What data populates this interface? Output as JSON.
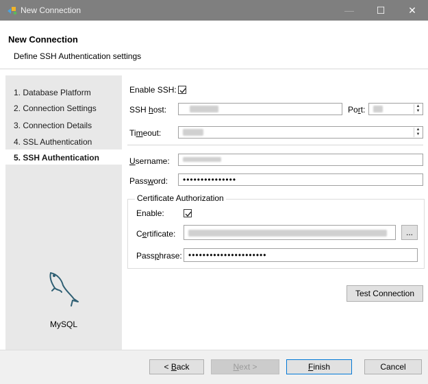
{
  "window": {
    "title": "New Connection",
    "minimize": "—",
    "maximize": "☐",
    "close": "✕"
  },
  "header": {
    "title": "New Connection",
    "subtitle": "Define SSH Authentication settings"
  },
  "steps": [
    {
      "label": "1. Database Platform"
    },
    {
      "label": "2. Connection Settings"
    },
    {
      "label": "3. Connection Details"
    },
    {
      "label": "4. SSL Authentication"
    },
    {
      "label": "5. SSH Authentication"
    }
  ],
  "sidebar": {
    "logo_label": "MySQL"
  },
  "form": {
    "enable_ssh_label": "Enable SSH:",
    "enable_ssh_checked": true,
    "ssh_host_label_pre": "SSH ",
    "ssh_host_label_u": "h",
    "ssh_host_label_post": "ost:",
    "port_label_pre": "Po",
    "port_label_u": "r",
    "port_label_post": "t:",
    "timeout_label_pre": "Ti",
    "timeout_label_u": "m",
    "timeout_label_post": "eout:",
    "username_label_pre": "",
    "username_label_u": "U",
    "username_label_post": "sername:",
    "password_label_pre": "Pass",
    "password_label_u": "w",
    "password_label_post": "ord:",
    "password_value": "•••••••••••••••",
    "cert_group_title": "Certificate Authorization",
    "cert_enable_label": "Enable:",
    "cert_enable_checked": true,
    "certificate_label_pre": "C",
    "certificate_label_u": "e",
    "certificate_label_post": "rtificate:",
    "browse_label": "...",
    "passphrase_label_pre": "Pass",
    "passphrase_label_u": "p",
    "passphrase_label_post": "hrase:",
    "passphrase_value": "••••••••••••••••••••••",
    "test_connection_label": "Test Connection"
  },
  "footer": {
    "back_pre": "< ",
    "back_u": "B",
    "back_post": "ack",
    "next_pre": "",
    "next_u": "N",
    "next_post": "ext >",
    "finish_pre": "",
    "finish_u": "F",
    "finish_post": "inish",
    "cancel_label": "Cancel"
  },
  "colors": {
    "titlebar": "#7f7f7f",
    "sidebar": "#e8e8e8",
    "accent": "#0078d7",
    "button": "#e1e1e1"
  }
}
